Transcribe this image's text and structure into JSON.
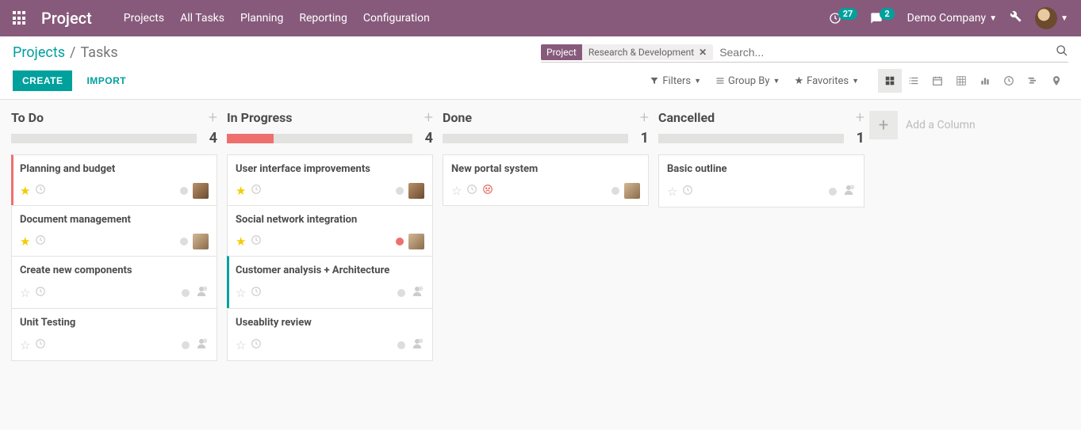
{
  "nav": {
    "brand": "Project",
    "items": [
      "Projects",
      "All Tasks",
      "Planning",
      "Reporting",
      "Configuration"
    ],
    "activity_count": "27",
    "msg_count": "2",
    "company": "Demo Company"
  },
  "breadcrumb": {
    "root": "Projects",
    "current": "Tasks"
  },
  "search": {
    "facet_label": "Project",
    "facet_value": "Research & Development",
    "placeholder": "Search..."
  },
  "buttons": {
    "create": "CREATE",
    "import": "IMPORT"
  },
  "opts": {
    "filters": "Filters",
    "groupby": "Group By",
    "favorites": "Favorites"
  },
  "addcol": "Add a Column",
  "columns": [
    {
      "title": "To Do",
      "count": "4",
      "red_pct": 0,
      "cards": [
        {
          "title": "Planning and budget",
          "star": true,
          "edge": "red",
          "avatar": "a",
          "dot": "grey"
        },
        {
          "title": "Document management",
          "star": true,
          "edge": "",
          "avatar": "b",
          "dot": "grey"
        },
        {
          "title": "Create new components",
          "star": false,
          "edge": "",
          "avatar": "cam",
          "dot": "grey"
        },
        {
          "title": "Unit Testing",
          "star": false,
          "edge": "",
          "avatar": "cam",
          "dot": "grey"
        }
      ]
    },
    {
      "title": "In Progress",
      "count": "4",
      "red_pct": 25,
      "cards": [
        {
          "title": "User interface improvements",
          "star": true,
          "edge": "",
          "avatar": "a",
          "dot": "grey"
        },
        {
          "title": "Social network integration",
          "star": true,
          "edge": "",
          "avatar": "b",
          "dot": "red"
        },
        {
          "title": "Customer analysis + Architecture",
          "star": false,
          "edge": "teal",
          "avatar": "cam",
          "dot": "grey"
        },
        {
          "title": "Useablity review",
          "star": false,
          "edge": "",
          "avatar": "cam",
          "dot": "grey"
        }
      ]
    },
    {
      "title": "Done",
      "count": "1",
      "red_pct": 0,
      "cards": [
        {
          "title": "New portal system",
          "star": false,
          "edge": "",
          "avatar": "b",
          "dot": "grey",
          "mood": true
        }
      ]
    },
    {
      "title": "Cancelled",
      "count": "1",
      "red_pct": 0,
      "cards": [
        {
          "title": "Basic outline",
          "star": false,
          "edge": "",
          "avatar": "cam",
          "dot": "grey"
        }
      ]
    }
  ]
}
